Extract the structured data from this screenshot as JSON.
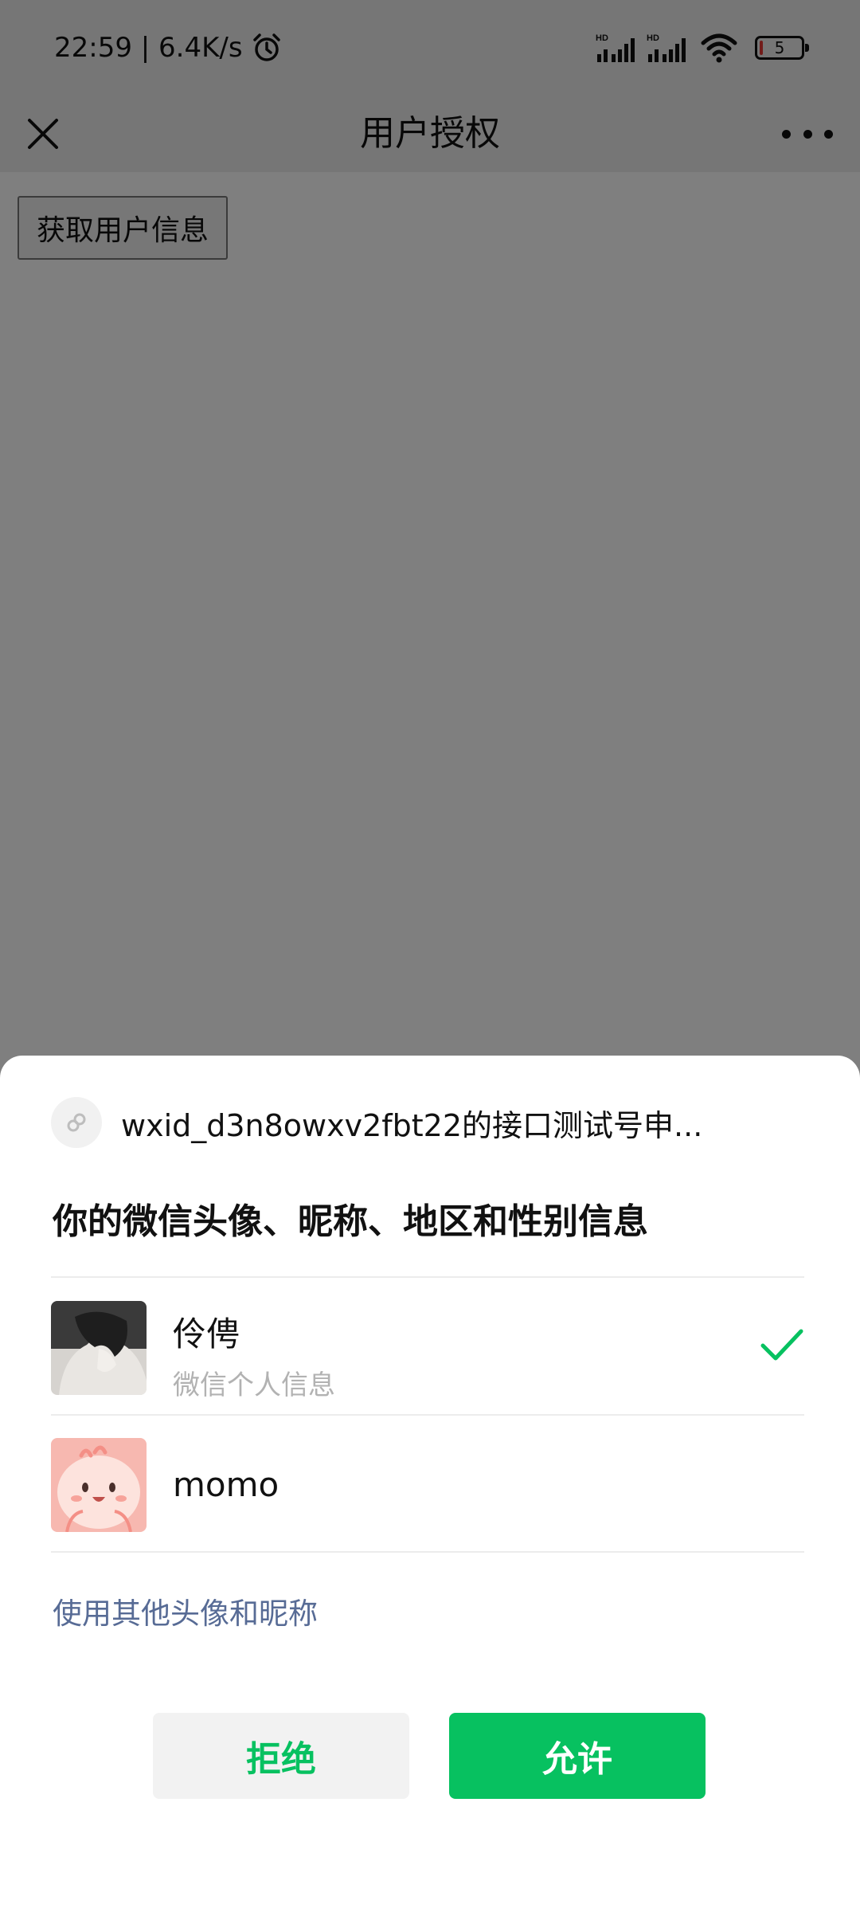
{
  "status_bar": {
    "time_speed": "22:59 | 6.4K/s",
    "signal_1_label": "HD",
    "signal_2_label": "HD",
    "battery_level": "5"
  },
  "nav": {
    "title": "用户授权"
  },
  "page": {
    "get_info_button": "获取用户信息"
  },
  "sheet": {
    "app_name": "wxid_d3n8owxv2fbt22的接口测试号申...",
    "scope_title": "你的微信头像、昵称、地区和性别信息",
    "accounts": [
      {
        "name": "伶俜",
        "subtitle": "微信个人信息",
        "selected": true
      },
      {
        "name": "momo",
        "subtitle": "",
        "selected": false
      }
    ],
    "other_link": "使用其他头像和昵称",
    "reject_label": "拒绝",
    "allow_label": "允许"
  },
  "colors": {
    "accent_green": "#07c160",
    "link_blue": "#576b95",
    "battery_low": "#e53935"
  },
  "icons": [
    "close-icon",
    "more-icon",
    "alarm-icon",
    "signal-icon",
    "wifi-icon",
    "battery-icon",
    "mini-program-icon",
    "check-icon"
  ]
}
